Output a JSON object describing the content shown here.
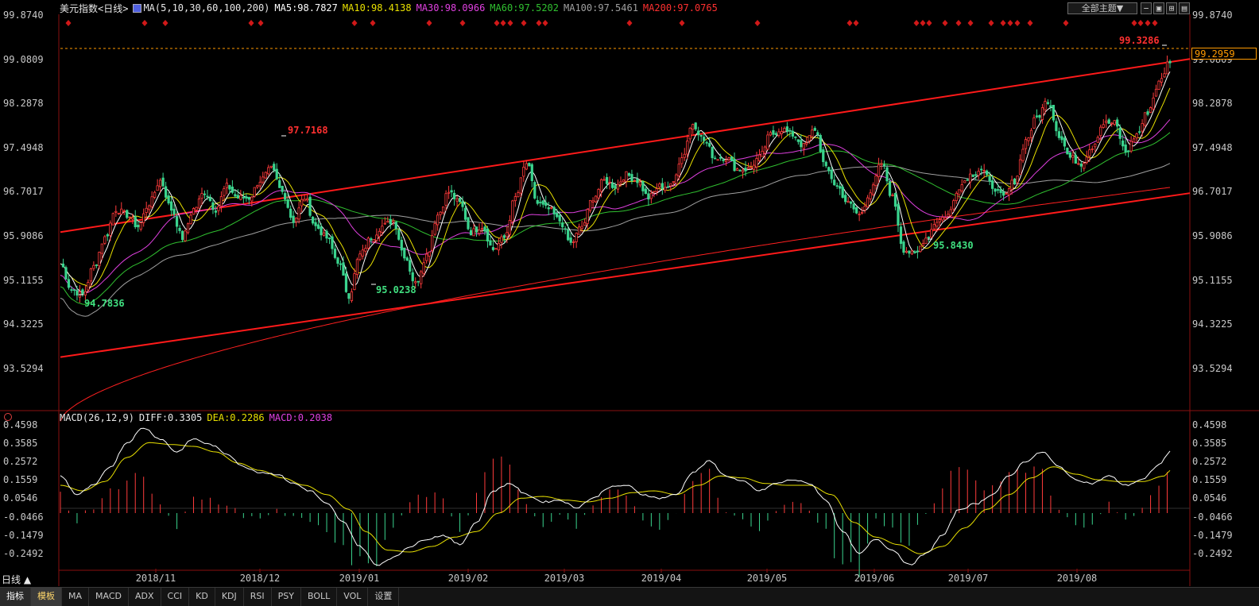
{
  "main_legend": {
    "title": "美元指数<日线>",
    "ma_label": "MA(5,10,30,60,100,200)",
    "ma5": "MA5:98.7827",
    "ma10": "MA10:98.4138",
    "ma30": "MA30:98.0966",
    "ma60": "MA60:97.5202",
    "ma100": "MA100:97.5461",
    "ma200": "MA200:97.0765"
  },
  "macd_legend": {
    "label": "MACD(26,12,9)",
    "diff": "DIFF:0.3305",
    "dea": "DEA:0.2286",
    "macd": "MACD:0.2038"
  },
  "toolbar": {
    "theme_button": "全部主题▼",
    "icons": [
      "minus-icon",
      "chart-icon",
      "maximize-icon",
      "restore-icon",
      "close-icon"
    ]
  },
  "colors": {
    "up": "#ff3b3b",
    "down": "#3ad48e",
    "ma5": "#ffffff",
    "ma10": "#e8e000",
    "ma30": "#e040e0",
    "ma60": "#30c030",
    "ma100": "#a0a0a0",
    "ma200": "#ff2020",
    "channel": "#ff1a1a",
    "dea": "#e8e000",
    "diff": "#ffffff"
  },
  "price_axis": [
    "99.8740",
    "99.0809",
    "98.2878",
    "97.4948",
    "96.7017",
    "95.9086",
    "95.1155",
    "94.3225",
    "93.5294"
  ],
  "macd_axis": [
    "0.4598",
    "0.3585",
    "0.2572",
    "0.1559",
    "0.0546",
    "-0.0466",
    "-0.1479",
    "-0.2492"
  ],
  "current_price": "99.2959",
  "annotations": {
    "high1": "97.7168",
    "low1": "94.7836",
    "low2": "95.0238",
    "low3": "95.8430",
    "high2": "99.3286"
  },
  "period_selector": "日线 ▲",
  "bottom_tabs": [
    "指标",
    "模板",
    "MA",
    "MACD",
    "ADX",
    "CCI",
    "KD",
    "KDJ",
    "RSI",
    "PSY",
    "BOLL",
    "VOL",
    "设置"
  ],
  "chart_data": {
    "type": "candlestick",
    "x_ticks": [
      "2018/11",
      "2018/12",
      "2019/01",
      "2019/02",
      "2019/03",
      "2019/04",
      "2019/05",
      "2019/06",
      "2019/07",
      "2019/08"
    ],
    "y_range": [
      93.2,
      100.1
    ],
    "macd_range": [
      -0.3,
      0.48
    ],
    "close_anchors": [
      [
        0,
        95.75
      ],
      [
        4,
        95.3
      ],
      [
        8,
        95.2
      ],
      [
        12,
        95.7
      ],
      [
        16,
        96.2
      ],
      [
        20,
        96.7
      ],
      [
        24,
        96.6
      ],
      [
        28,
        96.4
      ],
      [
        32,
        96.8
      ],
      [
        36,
        97.2
      ],
      [
        40,
        96.7
      ],
      [
        44,
        96.2
      ],
      [
        48,
        96.7
      ],
      [
        52,
        97.0
      ],
      [
        56,
        96.7
      ],
      [
        60,
        97.1
      ],
      [
        64,
        96.9
      ],
      [
        68,
        96.9
      ],
      [
        72,
        97.2
      ],
      [
        76,
        97.4
      ],
      [
        80,
        97.0
      ],
      [
        84,
        96.5
      ],
      [
        88,
        96.9
      ],
      [
        92,
        96.4
      ],
      [
        96,
        96.2
      ],
      [
        100,
        95.8
      ],
      [
        104,
        95.2
      ],
      [
        108,
        95.9
      ],
      [
        112,
        96.2
      ],
      [
        116,
        96.4
      ],
      [
        120,
        96.5
      ],
      [
        124,
        95.9
      ],
      [
        128,
        95.4
      ],
      [
        132,
        95.9
      ],
      [
        136,
        96.6
      ],
      [
        140,
        97.0
      ],
      [
        144,
        96.8
      ],
      [
        148,
        96.3
      ],
      [
        152,
        96.4
      ],
      [
        156,
        96.0
      ],
      [
        160,
        96.2
      ],
      [
        164,
        96.9
      ],
      [
        168,
        97.5
      ],
      [
        172,
        96.8
      ],
      [
        176,
        96.7
      ],
      [
        180,
        96.5
      ],
      [
        184,
        96.1
      ],
      [
        188,
        96.4
      ],
      [
        192,
        96.9
      ],
      [
        196,
        97.2
      ],
      [
        200,
        97.1
      ],
      [
        204,
        97.3
      ],
      [
        208,
        97.2
      ],
      [
        212,
        96.9
      ],
      [
        216,
        97.1
      ],
      [
        220,
        97.1
      ],
      [
        224,
        97.6
      ],
      [
        228,
        98.2
      ],
      [
        232,
        97.9
      ],
      [
        236,
        97.6
      ],
      [
        240,
        97.6
      ],
      [
        244,
        97.4
      ],
      [
        248,
        97.4
      ],
      [
        252,
        97.6
      ],
      [
        256,
        98.0
      ],
      [
        260,
        98.1
      ],
      [
        264,
        98.0
      ],
      [
        268,
        97.8
      ],
      [
        272,
        98.1
      ],
      [
        276,
        97.4
      ],
      [
        280,
        97.1
      ],
      [
        284,
        96.8
      ],
      [
        288,
        96.6
      ],
      [
        292,
        97.0
      ],
      [
        296,
        97.5
      ],
      [
        300,
        96.9
      ],
      [
        304,
        96.0
      ],
      [
        308,
        95.9
      ],
      [
        312,
        96.2
      ],
      [
        316,
        96.5
      ],
      [
        320,
        96.6
      ],
      [
        324,
        97.1
      ],
      [
        328,
        97.3
      ],
      [
        332,
        97.4
      ],
      [
        336,
        97.1
      ],
      [
        340,
        96.9
      ],
      [
        344,
        97.2
      ],
      [
        348,
        97.9
      ],
      [
        352,
        98.3
      ],
      [
        356,
        98.6
      ],
      [
        360,
        98.0
      ],
      [
        364,
        97.6
      ],
      [
        368,
        97.5
      ],
      [
        372,
        97.8
      ],
      [
        376,
        98.2
      ],
      [
        380,
        98.2
      ],
      [
        384,
        97.7
      ],
      [
        388,
        98.0
      ],
      [
        392,
        98.4
      ],
      [
        396,
        98.9
      ],
      [
        400,
        99.3
      ]
    ],
    "diff_anchors": [
      [
        0,
        0.2
      ],
      [
        6,
        0.1
      ],
      [
        12,
        0.15
      ],
      [
        18,
        0.25
      ],
      [
        24,
        0.38
      ],
      [
        30,
        0.46
      ],
      [
        36,
        0.4
      ],
      [
        42,
        0.33
      ],
      [
        48,
        0.4
      ],
      [
        54,
        0.37
      ],
      [
        60,
        0.32
      ],
      [
        66,
        0.25
      ],
      [
        72,
        0.22
      ],
      [
        78,
        0.21
      ],
      [
        84,
        0.16
      ],
      [
        90,
        0.12
      ],
      [
        96,
        0.05
      ],
      [
        102,
        -0.05
      ],
      [
        108,
        -0.18
      ],
      [
        114,
        -0.28
      ],
      [
        120,
        -0.24
      ],
      [
        126,
        -0.18
      ],
      [
        132,
        -0.14
      ],
      [
        138,
        -0.12
      ],
      [
        144,
        -0.17
      ],
      [
        150,
        -0.05
      ],
      [
        156,
        0.12
      ],
      [
        162,
        0.16
      ],
      [
        168,
        0.1
      ],
      [
        174,
        0.06
      ],
      [
        180,
        0.07
      ],
      [
        186,
        0.03
      ],
      [
        192,
        0.08
      ],
      [
        198,
        0.14
      ],
      [
        204,
        0.15
      ],
      [
        210,
        0.1
      ],
      [
        216,
        0.08
      ],
      [
        222,
        0.1
      ],
      [
        228,
        0.22
      ],
      [
        234,
        0.28
      ],
      [
        240,
        0.2
      ],
      [
        246,
        0.17
      ],
      [
        252,
        0.12
      ],
      [
        258,
        0.16
      ],
      [
        264,
        0.18
      ],
      [
        270,
        0.16
      ],
      [
        276,
        0.07
      ],
      [
        282,
        -0.1
      ],
      [
        288,
        -0.22
      ],
      [
        294,
        -0.14
      ],
      [
        300,
        -0.2
      ],
      [
        306,
        -0.28
      ],
      [
        312,
        -0.22
      ],
      [
        318,
        -0.12
      ],
      [
        324,
        0.02
      ],
      [
        330,
        0.05
      ],
      [
        336,
        0.1
      ],
      [
        342,
        0.2
      ],
      [
        348,
        0.28
      ],
      [
        354,
        0.33
      ],
      [
        360,
        0.25
      ],
      [
        366,
        0.18
      ],
      [
        372,
        0.16
      ],
      [
        378,
        0.2
      ],
      [
        384,
        0.15
      ],
      [
        390,
        0.18
      ],
      [
        396,
        0.26
      ],
      [
        400,
        0.33
      ]
    ],
    "dea_anchors": [
      [
        0,
        0.15
      ],
      [
        8,
        0.12
      ],
      [
        16,
        0.17
      ],
      [
        24,
        0.3
      ],
      [
        32,
        0.38
      ],
      [
        40,
        0.37
      ],
      [
        48,
        0.36
      ],
      [
        56,
        0.33
      ],
      [
        64,
        0.27
      ],
      [
        72,
        0.23
      ],
      [
        80,
        0.19
      ],
      [
        88,
        0.15
      ],
      [
        96,
        0.1
      ],
      [
        104,
        0.02
      ],
      [
        110,
        -0.1
      ],
      [
        118,
        -0.2
      ],
      [
        126,
        -0.21
      ],
      [
        134,
        -0.18
      ],
      [
        142,
        -0.13
      ],
      [
        150,
        -0.1
      ],
      [
        158,
        0.0
      ],
      [
        166,
        0.08
      ],
      [
        174,
        0.09
      ],
      [
        182,
        0.07
      ],
      [
        190,
        0.06
      ],
      [
        198,
        0.08
      ],
      [
        206,
        0.11
      ],
      [
        214,
        0.12
      ],
      [
        222,
        0.1
      ],
      [
        230,
        0.15
      ],
      [
        238,
        0.2
      ],
      [
        246,
        0.19
      ],
      [
        254,
        0.16
      ],
      [
        262,
        0.15
      ],
      [
        270,
        0.15
      ],
      [
        278,
        0.1
      ],
      [
        286,
        -0.05
      ],
      [
        294,
        -0.13
      ],
      [
        302,
        -0.17
      ],
      [
        310,
        -0.22
      ],
      [
        318,
        -0.18
      ],
      [
        326,
        -0.08
      ],
      [
        334,
        0.02
      ],
      [
        342,
        0.1
      ],
      [
        350,
        0.19
      ],
      [
        358,
        0.25
      ],
      [
        366,
        0.21
      ],
      [
        374,
        0.18
      ],
      [
        382,
        0.17
      ],
      [
        390,
        0.17
      ],
      [
        398,
        0.2
      ],
      [
        400,
        0.23
      ]
    ]
  }
}
